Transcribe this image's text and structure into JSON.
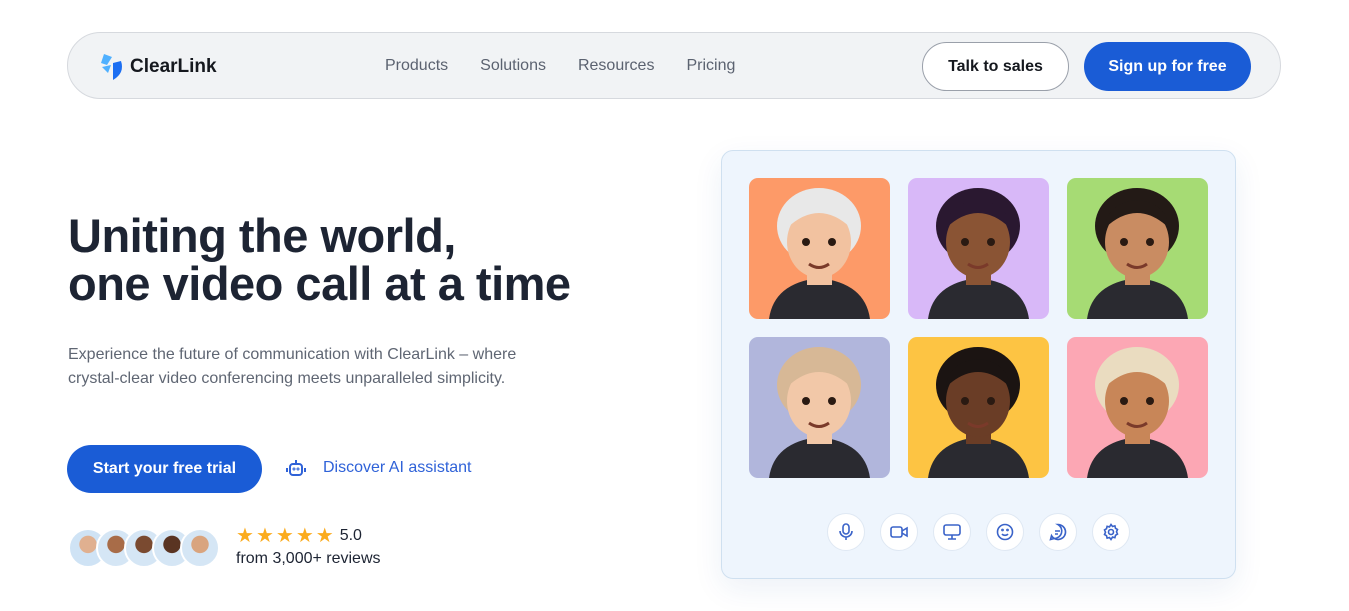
{
  "nav": {
    "brand": "ClearLink",
    "links": [
      "Products",
      "Solutions",
      "Resources",
      "Pricing"
    ],
    "talk_to_sales": "Talk to sales",
    "sign_up": "Sign up for free"
  },
  "hero": {
    "title_line1": "Uniting the world,",
    "title_line2": "one video call at a time",
    "subtitle": "Experience the future of communication with ClearLink – where crystal-clear video conferencing meets unparalleled simplicity.",
    "cta": "Start your free trial",
    "ai_link": "Discover AI assistant",
    "rating": {
      "stars": 5,
      "score": "5.0",
      "reviews": "from 3,000+ reviews"
    }
  },
  "call": {
    "tiles": [
      {
        "bg": "#fd9a68",
        "skin": "#f2c2a0",
        "hair": "#e8e8e8"
      },
      {
        "bg": "#d8b8f8",
        "skin": "#8a5434",
        "hair": "#2a1830"
      },
      {
        "bg": "#a6db74",
        "skin": "#c98c62",
        "hair": "#231a16"
      },
      {
        "bg": "#b1b6dc",
        "skin": "#f2c8a8",
        "hair": "#d7b896"
      },
      {
        "bg": "#fdc443",
        "skin": "#6a3d26",
        "hair": "#1b1412"
      },
      {
        "bg": "#fca7b4",
        "skin": "#c88658",
        "hair": "#eadcc0"
      }
    ],
    "controls": [
      "microphone",
      "camera",
      "screen-share",
      "emoji",
      "chat",
      "settings"
    ]
  },
  "colors": {
    "primary": "#1a5cd6",
    "star": "#fbab1c"
  }
}
